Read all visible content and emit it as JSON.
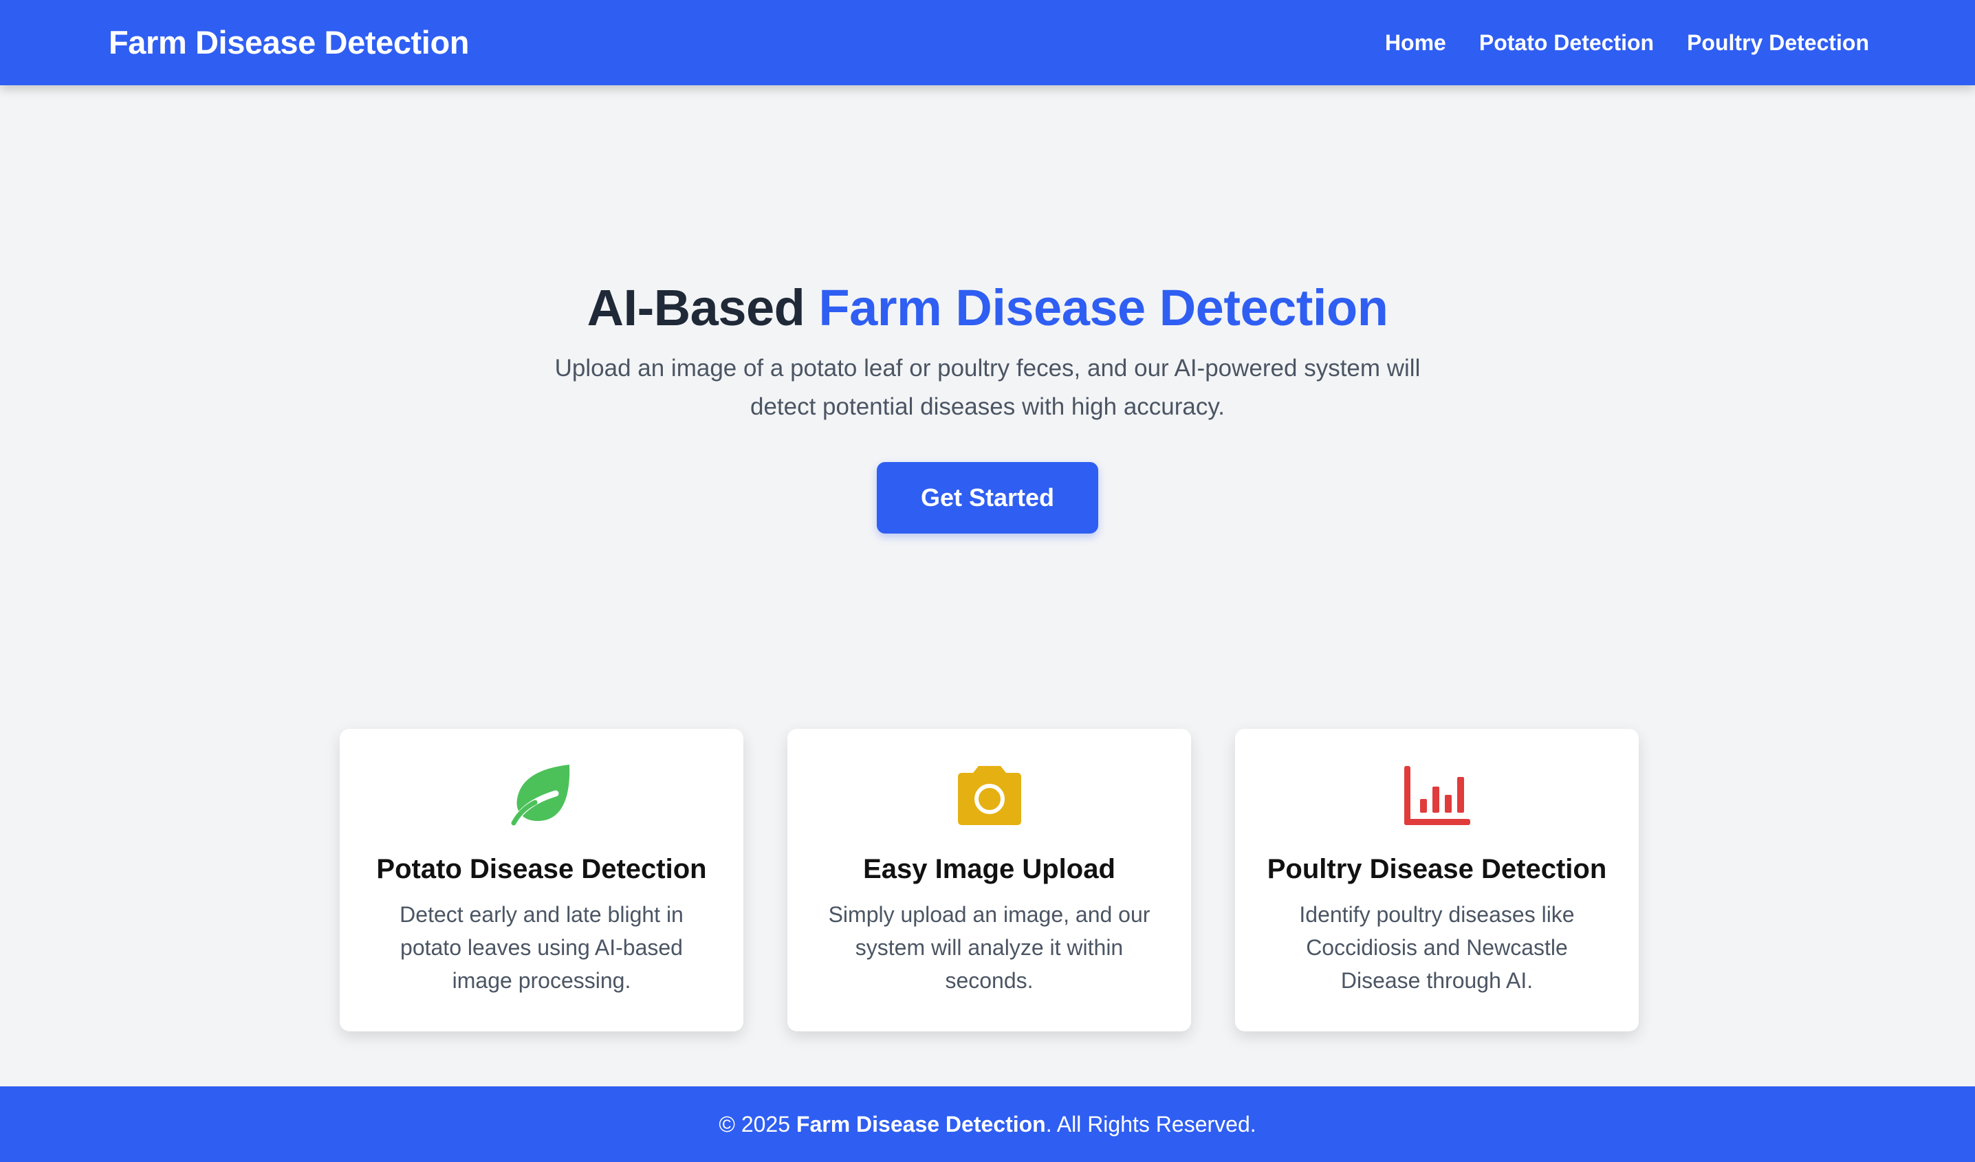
{
  "navbar": {
    "brand": "Farm Disease Detection",
    "links": [
      "Home",
      "Potato Detection",
      "Poultry Detection"
    ]
  },
  "hero": {
    "title_plain": "AI-Based ",
    "title_accent": "Farm Disease Detection",
    "subtitle": "Upload an image of a potato leaf or poultry feces, and our AI-powered system will detect potential diseases with high accuracy.",
    "cta_label": "Get Started"
  },
  "cards": [
    {
      "icon": "leaf-icon",
      "icon_color": "#4cc15a",
      "title": "Potato Disease Detection",
      "text": "Detect early and late blight in potato leaves using AI-based image processing."
    },
    {
      "icon": "camera-icon",
      "icon_color": "#e5b012",
      "title": "Easy Image Upload",
      "text": "Simply upload an image, and our system will analyze it within seconds."
    },
    {
      "icon": "bar-chart-icon",
      "icon_color": "#e03c3c",
      "title": "Poultry Disease Detection",
      "text": "Identify poultry diseases like Coccidiosis and Newcastle Disease through AI."
    }
  ],
  "footer": {
    "prefix": "© 2025 ",
    "brand": "Farm Disease Detection",
    "suffix": ". All Rights Reserved."
  },
  "colors": {
    "primary": "#2f5ef2",
    "background": "#f3f4f6",
    "heading": "#1f2937",
    "muted_text": "#4b5563"
  }
}
